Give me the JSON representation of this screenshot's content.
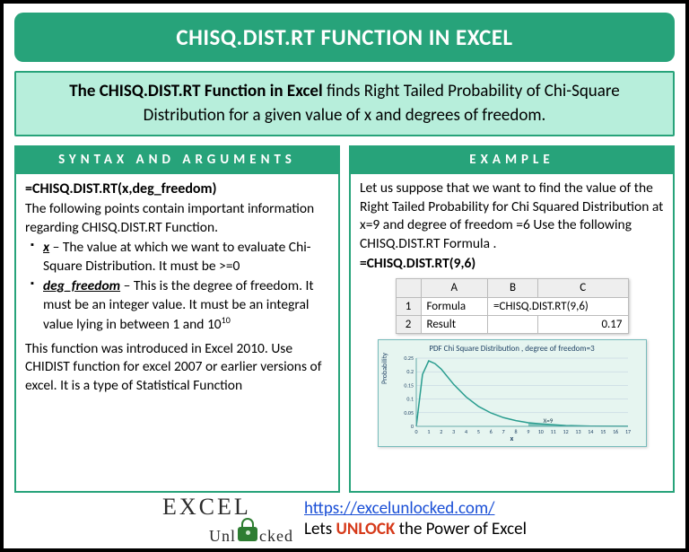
{
  "title": "CHISQ.DIST.RT FUNCTION IN EXCEL",
  "intro": {
    "bold": "The CHISQ.DIST.RT Function in Excel",
    "rest": " finds Right Tailed Probability of Chi-Square Distribution for a given value of x and degrees of freedom."
  },
  "left": {
    "header": "SYNTAX AND ARGUMENTS",
    "syntax": "=CHISQ.DIST.RT(x,deg_freedom)",
    "lead": "The following points contain important information regarding CHISQ.DIST.RT Function.",
    "args": [
      {
        "name": "x",
        "desc": " – The value at which we want to evaluate Chi-Square Distribution. It must be >=0"
      },
      {
        "name": "deg_freedom",
        "desc": " – This is the degree of freedom. It must be an integer value. It must be an integral value lying in between 1 and 10"
      }
    ],
    "exp": "10",
    "note": "This function was introduced in Excel 2010. Use CHIDIST function for excel 2007 or earlier versions of excel. It is a type of Statistical Function"
  },
  "right": {
    "header": "EXAMPLE",
    "desc": "Let us suppose that we want to find the value of the Right Tailed Probability for Chi Squared Distribution at x=9 and degree of freedom =6 Use the following CHISQ.DIST.RT Formula .",
    "formula": "=CHISQ.DIST.RT(9,6)",
    "table": {
      "colA": "A",
      "colB": "B",
      "colC": "C",
      "r1": "1",
      "r2": "2",
      "a1": "Formula",
      "b1": "=CHISQ.DIST.RT(9,6)",
      "a2": "Result",
      "c2": "0.17"
    }
  },
  "chart_data": {
    "type": "area",
    "title": "PDF Chi Square Distribution , degree of freedom=3",
    "xlabel": "x",
    "ylabel": "Probability",
    "xlim": [
      0,
      17
    ],
    "ylim": [
      0,
      0.25
    ],
    "yticks": [
      0,
      0.05,
      0.1,
      0.15,
      0.2,
      0.25
    ],
    "xticks": [
      0,
      1,
      2,
      3,
      4,
      5,
      6,
      7,
      8,
      9,
      10,
      11,
      12,
      13,
      14,
      15,
      16,
      17
    ],
    "annotation": "X=9",
    "series": [
      {
        "name": "pdf",
        "x": [
          0,
          0.5,
          1,
          1.5,
          2,
          3,
          4,
          5,
          6,
          7,
          8,
          9,
          10,
          12,
          14,
          17
        ],
        "values": [
          0,
          0.19,
          0.24,
          0.23,
          0.21,
          0.154,
          0.108,
          0.073,
          0.049,
          0.032,
          0.021,
          0.013,
          0.009,
          0.003,
          0.001,
          0.0003
        ]
      }
    ],
    "shade_from_x": 9
  },
  "footer": {
    "logo1": "EXC",
    "logo1b": "EL",
    "logo2": "Unl",
    "logo2b": "cked",
    "url": "https://excelunlocked.com/",
    "tag_pre": "Lets ",
    "unlock": "UNLOCK",
    "tag_post": " the Power of Excel"
  }
}
